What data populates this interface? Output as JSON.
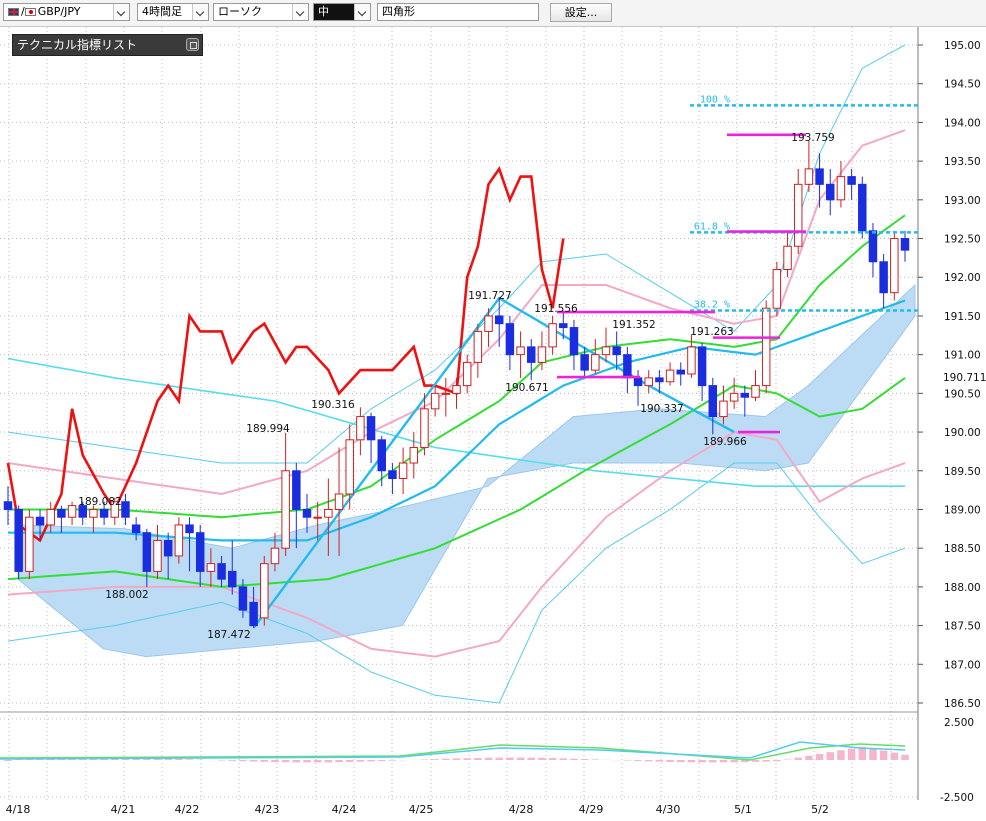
{
  "toolbar": {
    "pair": "GBP/JPY",
    "timeframe": "4時間足",
    "chart_type": "ローソク",
    "size": "中",
    "shape": "四角形",
    "settings_label": "設定..."
  },
  "indicator_panel": {
    "title": "テクニカル指標リスト"
  },
  "colors": {
    "up": "#cc2222",
    "down": "#1a2ee0",
    "rsi_like": "#ee1111",
    "zigzag": "#22bbee",
    "cloud": "#bcdcf5",
    "fib": "#22bbee",
    "marker": "#ee22dd"
  },
  "chart_data": {
    "type": "candlestick",
    "y_axis": {
      "min": 186.5,
      "max": 195.0,
      "ticks": [
        "195.00",
        "194.50",
        "194.00",
        "193.50",
        "193.00",
        "192.50",
        "192.00",
        "191.50",
        "191.00",
        "190.50",
        "190.00",
        "189.50",
        "189.00",
        "188.50",
        "188.00",
        "187.50",
        "187.00",
        "186.50"
      ]
    },
    "current_price": "190.711",
    "sub_axis": {
      "ticks": [
        "2.500",
        "-2.500"
      ]
    },
    "x_labels": [
      "4/18",
      "4/21",
      "4/22",
      "4/23",
      "4/24",
      "4/25",
      "4/28",
      "4/29",
      "4/30",
      "5/1",
      "5/2"
    ],
    "annotations": [
      {
        "text": "189.082",
        "x": "4/18-4/21",
        "y": 189.082
      },
      {
        "text": "188.002",
        "x": "4/21",
        "y": 188.002
      },
      {
        "text": "189.994",
        "x": "4/22",
        "y": 189.994
      },
      {
        "text": "187.472",
        "x": "4/22",
        "y": 187.472
      },
      {
        "text": "190.316",
        "x": "4/23-4/24",
        "y": 190.316
      },
      {
        "text": "191.727",
        "x": "4/25",
        "y": 191.727
      },
      {
        "text": "191.556",
        "x": "4/28",
        "y": 191.556
      },
      {
        "text": "190.671",
        "x": "4/28",
        "y": 190.671
      },
      {
        "text": "191.352",
        "x": "4/29",
        "y": 191.352
      },
      {
        "text": "190.337",
        "x": "4/30",
        "y": 190.337
      },
      {
        "text": "191.263",
        "x": "4/30",
        "y": 191.263
      },
      {
        "text": "189.966",
        "x": "4/30-5/1",
        "y": 189.966
      },
      {
        "text": "193.759",
        "x": "5/1-5/2",
        "y": 193.759
      }
    ],
    "fib_levels": [
      {
        "label": "100 %",
        "value": 194.22
      },
      {
        "label": "61.8 %",
        "value": 192.58
      },
      {
        "label": "38.2 %",
        "value": 191.57
      }
    ],
    "candles": [
      [
        189.1,
        189.0,
        189.3,
        188.8
      ],
      [
        189.0,
        188.2,
        189.05,
        188.1
      ],
      [
        188.2,
        188.9,
        189.0,
        188.1
      ],
      [
        188.9,
        188.8,
        189.0,
        188.6
      ],
      [
        188.8,
        189.0,
        189.1,
        188.7
      ],
      [
        189.0,
        188.9,
        189.05,
        188.7
      ],
      [
        188.9,
        189.05,
        189.1,
        188.8
      ],
      [
        189.05,
        188.9,
        189.1,
        188.8
      ],
      [
        188.9,
        189.0,
        189.05,
        188.7
      ],
      [
        189.0,
        188.9,
        189.1,
        188.8
      ],
      [
        188.9,
        189.1,
        189.15,
        188.8
      ],
      [
        189.1,
        188.9,
        189.2,
        188.8
      ],
      [
        188.8,
        188.7,
        188.9,
        188.6
      ],
      [
        188.7,
        188.2,
        188.75,
        188.0
      ],
      [
        188.2,
        188.6,
        188.8,
        188.1
      ],
      [
        188.6,
        188.4,
        188.7,
        188.1
      ],
      [
        188.4,
        188.8,
        188.9,
        188.3
      ],
      [
        188.8,
        188.7,
        188.9,
        188.2
      ],
      [
        188.7,
        188.2,
        188.8,
        188.0
      ],
      [
        188.2,
        188.3,
        188.5,
        188.0
      ],
      [
        188.3,
        188.1,
        188.4,
        188.0
      ],
      [
        188.2,
        188.0,
        188.6,
        187.9
      ],
      [
        188.0,
        187.7,
        188.1,
        187.6
      ],
      [
        187.8,
        187.5,
        188.0,
        187.47
      ],
      [
        187.6,
        188.3,
        188.4,
        187.5
      ],
      [
        188.3,
        188.5,
        188.7,
        188.2
      ],
      [
        188.5,
        189.5,
        189.99,
        188.4
      ],
      [
        189.5,
        189.0,
        189.6,
        188.5
      ],
      [
        189.0,
        188.9,
        189.2,
        188.7
      ],
      [
        188.9,
        188.9,
        189.1,
        188.6
      ],
      [
        188.9,
        189.0,
        189.4,
        188.4
      ],
      [
        189.0,
        189.2,
        189.8,
        188.4
      ],
      [
        189.2,
        189.9,
        190.1,
        189.0
      ],
      [
        189.9,
        190.2,
        190.32,
        189.7
      ],
      [
        190.2,
        189.9,
        190.25,
        189.6
      ],
      [
        189.9,
        189.5,
        189.95,
        189.3
      ],
      [
        189.5,
        189.4,
        189.6,
        189.2
      ],
      [
        189.4,
        189.6,
        189.8,
        189.2
      ],
      [
        189.6,
        189.8,
        190.0,
        189.4
      ],
      [
        189.8,
        190.3,
        190.5,
        189.7
      ],
      [
        190.3,
        190.5,
        190.6,
        190.2
      ],
      [
        190.5,
        190.5,
        190.7,
        190.2
      ],
      [
        190.5,
        190.6,
        190.7,
        190.3
      ],
      [
        190.6,
        190.9,
        191.0,
        190.5
      ],
      [
        190.9,
        191.3,
        191.4,
        190.7
      ],
      [
        191.3,
        191.5,
        191.6,
        191.1
      ],
      [
        191.5,
        191.4,
        191.73,
        191.1
      ],
      [
        191.4,
        191.0,
        191.5,
        190.8
      ],
      [
        191.0,
        191.1,
        191.3,
        190.7
      ],
      [
        191.1,
        190.9,
        191.2,
        190.67
      ],
      [
        190.9,
        191.1,
        191.3,
        190.8
      ],
      [
        191.1,
        191.4,
        191.5,
        191.0
      ],
      [
        191.4,
        191.35,
        191.56,
        191.2
      ],
      [
        191.35,
        191.0,
        191.45,
        190.8
      ],
      [
        191.0,
        190.8,
        191.1,
        190.7
      ],
      [
        190.8,
        191.0,
        191.2,
        190.75
      ],
      [
        191.0,
        191.1,
        191.35,
        190.9
      ],
      [
        191.1,
        191.0,
        191.3,
        190.8
      ],
      [
        191.0,
        190.7,
        191.1,
        190.5
      ],
      [
        190.7,
        190.6,
        190.8,
        190.34
      ],
      [
        190.6,
        190.7,
        190.8,
        190.5
      ],
      [
        190.7,
        190.65,
        190.8,
        190.5
      ],
      [
        190.65,
        190.8,
        190.9,
        190.6
      ],
      [
        190.8,
        190.75,
        190.9,
        190.6
      ],
      [
        190.75,
        191.1,
        191.26,
        190.7
      ],
      [
        191.1,
        190.6,
        191.15,
        190.4
      ],
      [
        190.6,
        190.2,
        190.7,
        189.97
      ],
      [
        190.2,
        190.4,
        190.6,
        190.1
      ],
      [
        190.4,
        190.5,
        190.7,
        190.3
      ],
      [
        190.5,
        190.45,
        190.6,
        190.2
      ],
      [
        190.45,
        190.6,
        190.8,
        190.4
      ],
      [
        190.6,
        191.6,
        191.7,
        190.5
      ],
      [
        191.6,
        192.1,
        192.2,
        191.5
      ],
      [
        192.1,
        192.4,
        192.6,
        192.0
      ],
      [
        192.4,
        193.2,
        193.4,
        192.3
      ],
      [
        193.2,
        193.4,
        193.76,
        193.1
      ],
      [
        193.4,
        193.2,
        193.6,
        192.9
      ],
      [
        193.2,
        193.0,
        193.4,
        192.8
      ],
      [
        193.0,
        193.3,
        193.5,
        192.9
      ],
      [
        193.3,
        193.2,
        193.4,
        193.0
      ],
      [
        193.2,
        192.6,
        193.3,
        192.5
      ],
      [
        192.6,
        192.2,
        192.7,
        192.0
      ],
      [
        192.2,
        191.8,
        192.3,
        191.6
      ],
      [
        191.8,
        192.5,
        192.6,
        191.7
      ],
      [
        192.5,
        192.35,
        192.6,
        192.2
      ]
    ]
  }
}
